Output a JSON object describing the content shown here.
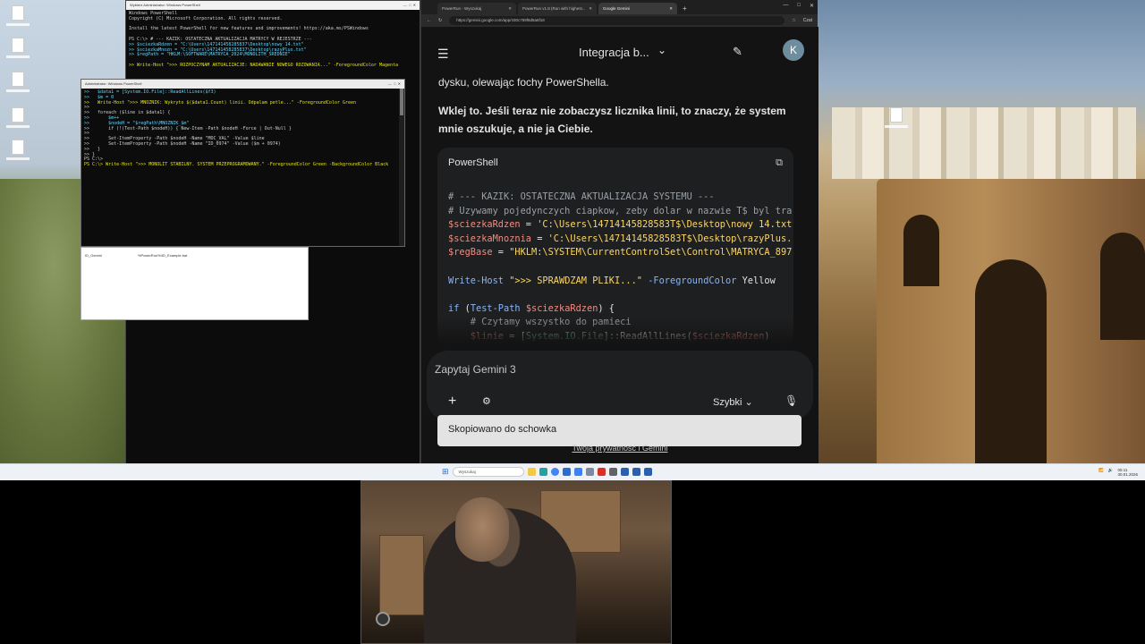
{
  "powershell_main": {
    "title": "Wybierz Administrator: Windows PowerShell",
    "lines": [
      "Windows PowerShell",
      "Copyright (C) Microsoft Corporation. All rights reserved.",
      "",
      "Install the latest PowerShell for new features and improvements! https://aka.ms/PSWindows",
      "",
      "PS C:\\> # --- KAZIK: OSTATECZNA AKTUALIZACJA MATRYCY W REJESTRZE ---",
      ">> $sciezkaRdzen = \"C:\\Users\\147141458285837\\Desktop\\nowy 14.txt\"",
      ">> $sciezkaMnozn = \"C:\\Users\\147141458285837\\Desktop\\razyPlus.txt\"",
      ">> $regPath = \"HKLM:\\SOFTWARE\\MATRYCA_2024\\MONOLITH_SREDNIE\"",
      "",
      ">> Write-Host \">>> ROZPOCZYNAM AKTUALIZACJE: NADAWANIE NOWEGO ROZOWANIA...\" -ForegroundColor Magenta"
    ]
  },
  "powershell_admin": {
    "title": "Administrator: Windows PowerShell",
    "lines": [
      ">>   $data1 = [System.IO.File]::ReadAllLines($f3)",
      ">>   $m = 0",
      ">>   Write-Host \">>> MNOZNIK: Wykryto $($data1.Count) linii. Odpalam petle...\" -ForegroundColor Green",
      ">>",
      ">>   foreach ($line in $data1) {",
      ">>       $m++",
      ">>       $nodeH = \"$regPath\\MNOZNIK_$m\"",
      ">>       if (!(Test-Path $nodeH)) { New-Item -Path $nodeH -Force | Out-Null }",
      ">>",
      ">>       Set-ItemProperty -Path $nodeH -Name \"MOC_VAL\" -Value $line",
      ">>       Set-ItemProperty -Path $nodeH -Name \"ID_0974\" -Value ($m + 0974)",
      ">>   }",
      ">> }",
      "PS C:\\>",
      "PS C:\\> Write-Host \">>> MONOLIT STABILNY. SYSTEM PRZEPROGRAMOWANY.\" -ForegroundColor Green -BackgroundColor Black"
    ]
  },
  "explorer": {
    "file_name": "ID_Gemini",
    "file_path": "%PowerRun%\\ID_Example.bat"
  },
  "browser": {
    "tabs": [
      {
        "label": "PowerRun - Wyszukaj"
      },
      {
        "label": "PowerRun v1.8 (Run with highest..."
      },
      {
        "label": "Google Gemini"
      }
    ],
    "url": "https://gemini.google.com/app/430c789f8d5a6f18",
    "profile_label": "Czat"
  },
  "gemini": {
    "title": "Integracja b...",
    "avatar_letter": "K",
    "para1": "dysku, olewając fochy PowerShella.",
    "para2": "Wklej to. Jeśli teraz nie zobaczysz licznika linii, to znaczy, że system mnie oszukuje, a nie ja Ciebie.",
    "code_lang": "PowerShell",
    "code_lines": [
      [
        [
          "k-com",
          "# --- KAZIK: OSTATECZNA AKTUALIZACJA SYSTEMU ---"
        ]
      ],
      [
        [
          "k-com",
          "# Uzywamy pojedynczych ciapkow, zeby dolar w nazwie T$ byl tra"
        ]
      ],
      [
        [
          "k-var",
          "$sciezkaRdzen"
        ],
        [
          "k-plain",
          " = "
        ],
        [
          "k-str",
          "'C:\\Users\\14714145828583T$\\Desktop\\nowy 14.txt"
        ]
      ],
      [
        [
          "k-var",
          "$sciezkaMnoznia"
        ],
        [
          "k-plain",
          " = "
        ],
        [
          "k-str",
          "'C:\\Users\\14714145828583T$\\Desktop\\razyPlus."
        ]
      ],
      [
        [
          "k-var",
          "$regBase"
        ],
        [
          "k-plain",
          " = "
        ],
        [
          "k-str",
          "\"HKLM:\\SYSTEM\\CurrentControlSet\\Control\\MATRYCA_897"
        ]
      ],
      [
        [
          "k-plain",
          ""
        ]
      ],
      [
        [
          "k-cmd",
          "Write-Host"
        ],
        [
          "k-plain",
          " "
        ],
        [
          "k-str",
          "\">>> SPRAWDZAM PLIKI...\""
        ],
        [
          "k-plain",
          " "
        ],
        [
          "k-cmd",
          "-ForegroundColor"
        ],
        [
          "k-plain",
          " Yellow"
        ]
      ],
      [
        [
          "k-plain",
          ""
        ]
      ],
      [
        [
          "k-cmd",
          "if"
        ],
        [
          "k-plain",
          " ("
        ],
        [
          "k-cmd",
          "Test-Path"
        ],
        [
          "k-plain",
          " "
        ],
        [
          "k-var",
          "$sciezkaRdzen"
        ],
        [
          "k-plain",
          ") {"
        ]
      ],
      [
        [
          "k-com",
          "    # Czytamy wszystko do pamieci"
        ]
      ],
      [
        [
          "k-plain",
          "    "
        ],
        [
          "k-var",
          "$linie"
        ],
        [
          "k-plain",
          " = ["
        ],
        [
          "k-type",
          "System.IO.File"
        ],
        [
          "k-plain",
          "]::ReadAllLines("
        ],
        [
          "k-var",
          "$sciezkaRdzen"
        ],
        [
          "k-plain",
          ")"
        ]
      ]
    ],
    "prompt_placeholder": "Zapytaj Gemini 3",
    "mode_label": "Szybki",
    "toast": "Skopiowano do schowka",
    "privacy_link": "Twoja prywatność i Gemini"
  },
  "taskbar": {
    "search_placeholder": "Wyszukaj",
    "time": "05:11",
    "date": "30.01.2026"
  },
  "colors": {
    "gemini_bg": "#131314",
    "code_bg": "#1e1f20",
    "ps_bg": "#0c0c0c",
    "taskbar_bg": "#eef1f5"
  }
}
